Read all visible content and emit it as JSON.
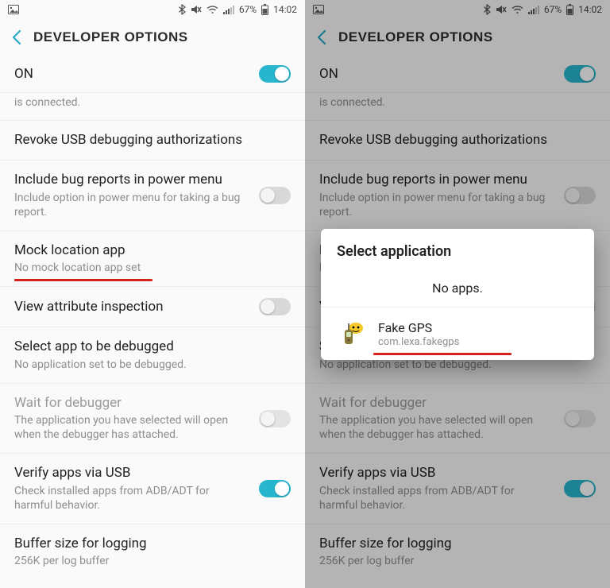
{
  "status": {
    "battery": "67%",
    "time": "14:02"
  },
  "header": {
    "title": "DEVELOPER OPTIONS"
  },
  "main": {
    "on_label": "ON",
    "fragment": "is connected.",
    "items": {
      "revoke": {
        "title": "Revoke USB debugging authorizations"
      },
      "bugreport": {
        "title": "Include bug reports in power menu",
        "sub": "Include option in power menu for taking a bug report."
      },
      "mock": {
        "title": "Mock location app",
        "sub": "No mock location app set"
      },
      "viewattr": {
        "title": "View attribute inspection"
      },
      "selectdebug": {
        "title": "Select app to be debugged",
        "sub": "No application set to be debugged."
      },
      "waitdebug": {
        "title": "Wait for debugger",
        "sub": "The application you have selected will open when the debugger has attached."
      },
      "verifyusb": {
        "title": "Verify apps via USB",
        "sub": "Check installed apps from ADB/ADT for harmful behavior."
      },
      "buffer": {
        "title": "Buffer size for logging",
        "sub": "256K per log buffer"
      }
    }
  },
  "dialog": {
    "title": "Select application",
    "none_label": "No apps.",
    "app": {
      "name": "Fake GPS",
      "pkg": "com.lexa.fakegps"
    }
  }
}
